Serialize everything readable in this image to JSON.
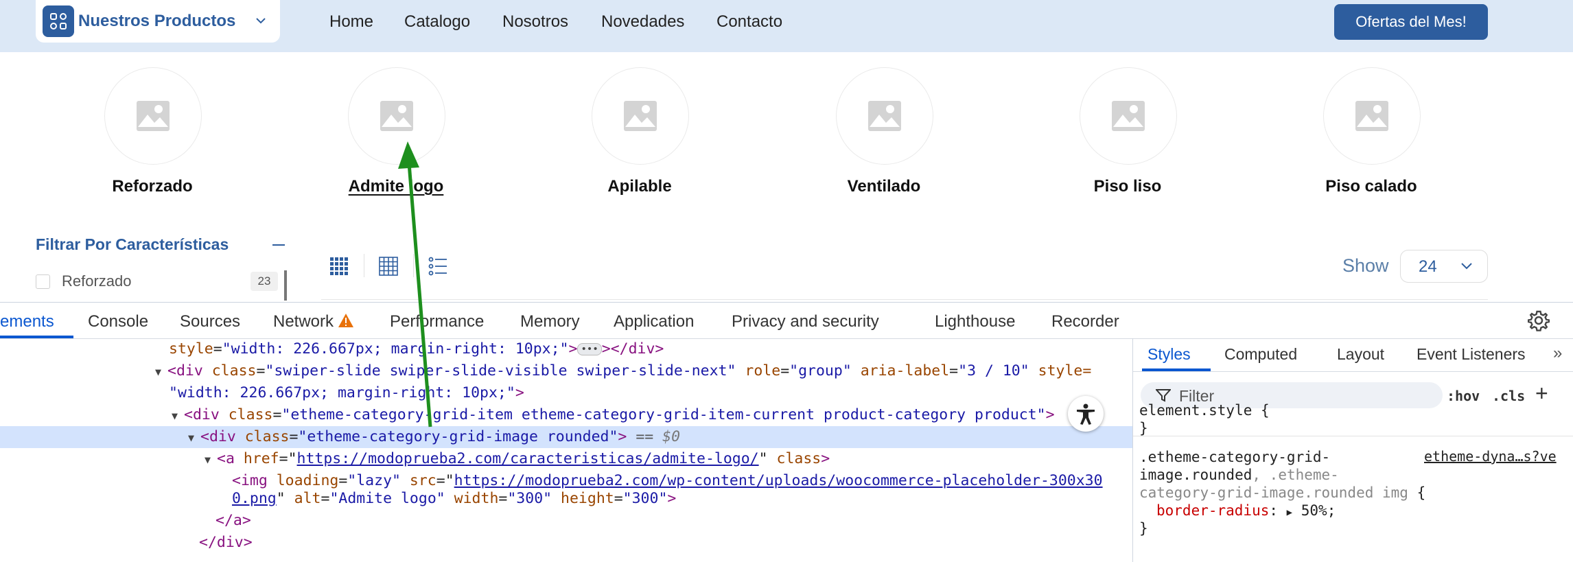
{
  "header": {
    "products_label": "Nuestros Productos",
    "nav": [
      "Home",
      "Catalogo",
      "Nosotros",
      "Novedades",
      "Contacto"
    ],
    "offer_button": "Ofertas del Mes!"
  },
  "categories": [
    "Reforzado",
    "Admite logo",
    "Apilable",
    "Ventilado",
    "Piso liso",
    "Piso calado"
  ],
  "filter": {
    "title": "Filtrar Por Características",
    "items": [
      {
        "label": "Reforzado",
        "count": "23"
      }
    ]
  },
  "toolbar": {
    "show_label": "Show",
    "show_value": "24"
  },
  "devtools": {
    "tabs": [
      "ements",
      "Console",
      "Sources",
      "Network",
      "Performance",
      "Memory",
      "Application",
      "Privacy and security",
      "Lighthouse",
      "Recorder"
    ],
    "active_tab": "ements",
    "elements": {
      "l1_attr": "style",
      "l1_val": "\"width: 226.667px; margin-right: 10px;\"",
      "l1_end": "></div>",
      "l2_tag": "<div",
      "l2_a1": "class",
      "l2_v1": "\"swiper-slide swiper-slide-visible swiper-slide-next\"",
      "l2_a2": "role",
      "l2_v2": "\"group\"",
      "l2_a3": "aria-label",
      "l2_v3": "\"3 / 10\"",
      "l2_a4": "style=",
      "l3_val": "\"width: 226.667px; margin-right: 10px;\"",
      "l3_end": ">",
      "l4_tag": "<div",
      "l4_a1": "class",
      "l4_v1": "\"etheme-category-grid-item etheme-category-grid-item-current product-category product\"",
      "l4_end": ">",
      "l5_tag": "<div",
      "l5_a1": "class",
      "l5_v1": "\"etheme-category-grid-image rounded\"",
      "l5_end": ">",
      "l5_eq": "==",
      "l5_dollar": "$0",
      "l6_tag": "<a",
      "l6_a1": "href",
      "l6_link": "https://modoprueba2.com/caracteristicas/admite-logo/",
      "l6_a2": "class",
      "l6_end": ">",
      "l7_tag": "<img",
      "l7_a1": "loading",
      "l7_v1": "\"lazy\"",
      "l7_a2": "src",
      "l7_link": "https://modoprueba2.com/wp-content/uploads/woocommerce-placeholder-300x30",
      "l8_link": "0.png",
      "l8_a1": "alt",
      "l8_v1": "\"Admite logo\"",
      "l8_a2": "width",
      "l8_v2": "\"300\"",
      "l8_a3": "height",
      "l8_v3": "\"300\"",
      "l8_end": ">",
      "l9": "</a>",
      "l10": "</div>"
    },
    "styles": {
      "tabs": [
        "Styles",
        "Computed",
        "Layout",
        "Event Listeners"
      ],
      "more": "»",
      "filter_placeholder": "Filter",
      "hov": ":hov",
      "cls": ".cls",
      "element_style": "element.style {",
      "close_brace": "}",
      "rule_sel_1": ".etheme-category-grid-",
      "rule_sel_2a": "image.rounded",
      "rule_sel_2b": ".etheme-",
      "rule_sel_3": "category-grid-image.rounded img {",
      "source": "etheme-dyna…s?ve",
      "prop": "border-radius",
      "value": "50%;"
    }
  }
}
